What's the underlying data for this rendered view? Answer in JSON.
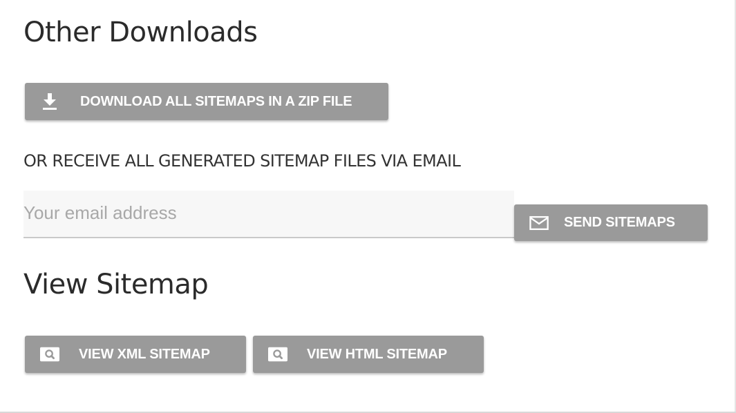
{
  "other_downloads": {
    "heading": "Other Downloads",
    "zip_button": {
      "label": "DOWNLOAD ALL SITEMAPS IN A ZIP FILE",
      "icon": "download-icon"
    },
    "email_prompt": "OR RECEIVE ALL GENERATED SITEMAP FILES VIA EMAIL",
    "email_input": {
      "placeholder": "Your email address",
      "value": ""
    },
    "send_button": {
      "label": "SEND SITEMAPS",
      "icon": "mail-icon"
    }
  },
  "view_sitemap": {
    "heading": "View Sitemap",
    "xml_button": {
      "label": "VIEW XML SITEMAP",
      "icon": "search-icon"
    },
    "html_button": {
      "label": "VIEW HTML SITEMAP",
      "icon": "search-icon"
    }
  },
  "colors": {
    "button_bg": "#9a9a9a",
    "button_text": "#ffffff",
    "heading_text": "#2b2b2b",
    "input_bg": "#f7f7f7",
    "placeholder": "#a8a8a8"
  }
}
